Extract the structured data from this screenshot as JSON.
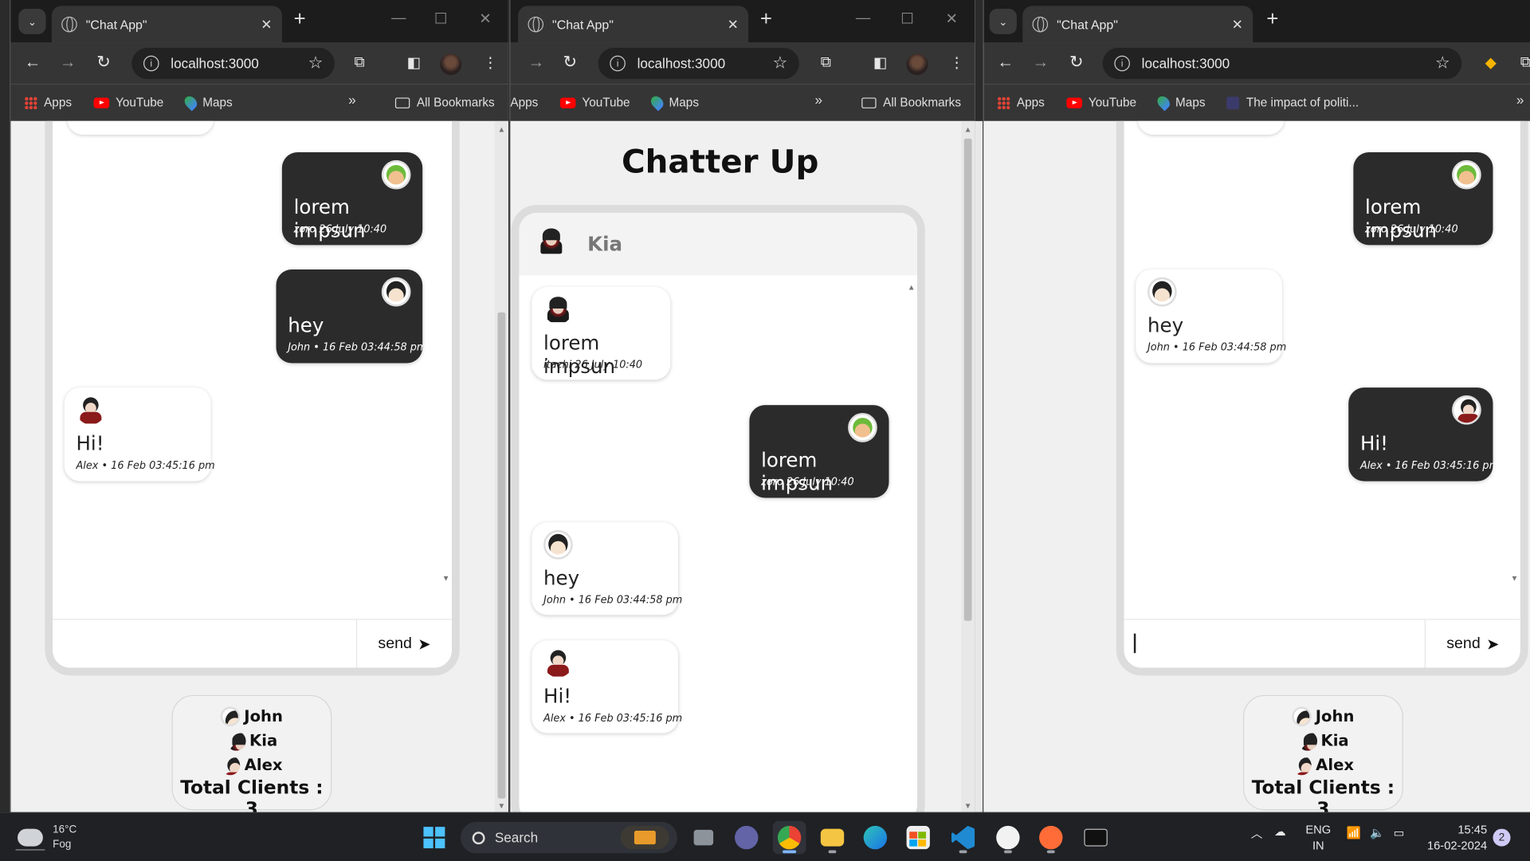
{
  "browser": {
    "tab_title": "\"Chat App\"",
    "url": "localhost:3000",
    "bookmarks": {
      "apps": "Apps",
      "youtube": "YouTube",
      "maps": "Maps",
      "extra": "The impact of politi...",
      "all": "All Bookmarks"
    }
  },
  "app": {
    "title": "Chatter Up",
    "chat_header_name": "Kia",
    "send_label": "send",
    "clients": [
      "John",
      "Kia",
      "Alex"
    ],
    "total_label": "Total Clients : 3"
  },
  "messages": {
    "itachi": {
      "text": "lorem impsun",
      "meta": "itachi 26 July 10:40"
    },
    "zoro": {
      "text": "lorem impsun",
      "meta": "zoro 26 July 10:40"
    },
    "john": {
      "text": "hey",
      "meta": "John • 16 Feb 03:44:58 pm"
    },
    "alex": {
      "text": "Hi!",
      "meta": "Alex • 16 Feb 03:45:16 pm"
    }
  },
  "taskbar": {
    "temp": "16°C",
    "weather": "Fog",
    "search": "Search",
    "lang1": "ENG",
    "lang2": "IN",
    "time": "15:45",
    "date": "16-02-2024",
    "notifications": "2"
  }
}
